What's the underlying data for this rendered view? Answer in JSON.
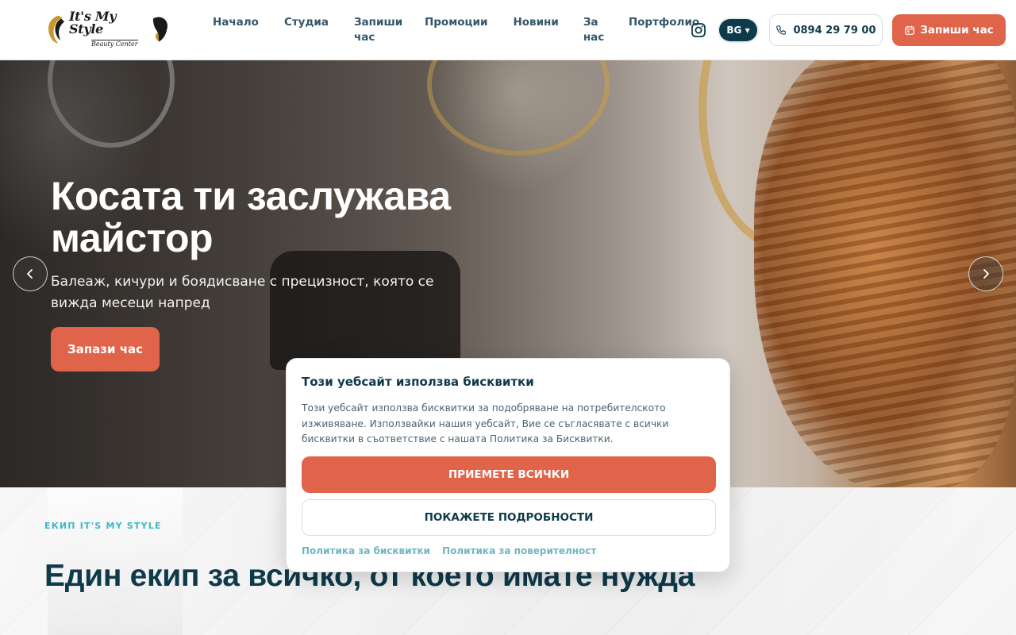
{
  "header": {
    "logo": {
      "main": "It's My Style",
      "sub": "Beauty Center"
    },
    "nav": [
      {
        "label": "Начало"
      },
      {
        "label": "Студиа"
      },
      {
        "label": "Запиши час"
      },
      {
        "label": "Промоции"
      },
      {
        "label": "Новини"
      },
      {
        "label": "За нас"
      },
      {
        "label": "Портфолио"
      }
    ],
    "language": "BG ▾",
    "phone": "0894 29 79 00",
    "book_label": "Запиши час"
  },
  "hero": {
    "title": "Косата ти заслужава майстор",
    "subtitle": "Балеаж, кичури и боядисване с прецизност, която се вижда месеци напред",
    "cta": "Запази час"
  },
  "section": {
    "eyebrow": "ЕКИП IT'S MY STYLE",
    "title": "Един екип за всичко, от което имате нужда"
  },
  "cookie": {
    "title": "Този уебсайт използва бисквитки",
    "text": "Този уебсайт използва бисквитки за подобряване на потребителското изживяване. Използвайки нашия уебсайт, Вие се съгласявате с всички бисквитки в съответствие с нашата Политика за Бисквитки.",
    "accept": "ПРИЕМЕТЕ ВСИЧКИ",
    "details": "ПОКАЖЕТЕ ПОДРОБНОСТИ",
    "links": [
      "Политика за бисквитки",
      "Политика за поверителност"
    ]
  },
  "colors": {
    "accent": "#e0644a",
    "navy": "#0e3a4a",
    "teal": "#3fb7c6"
  },
  "icons": [
    "instagram-icon",
    "phone-icon",
    "calendar-icon",
    "chevron-left-icon",
    "chevron-right-icon"
  ]
}
